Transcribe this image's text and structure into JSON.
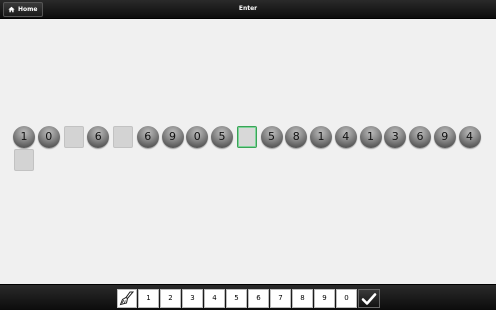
{
  "topbar": {
    "home_label": "Home",
    "title": "Enter"
  },
  "sequence": [
    {
      "type": "digit",
      "value": "1"
    },
    {
      "type": "digit",
      "value": "0"
    },
    {
      "type": "blank"
    },
    {
      "type": "digit",
      "value": "6"
    },
    {
      "type": "blank"
    },
    {
      "type": "digit",
      "value": "6"
    },
    {
      "type": "digit",
      "value": "9"
    },
    {
      "type": "digit",
      "value": "0"
    },
    {
      "type": "digit",
      "value": "5"
    },
    {
      "type": "blank",
      "active": true
    },
    {
      "type": "digit",
      "value": "5"
    },
    {
      "type": "digit",
      "value": "8"
    },
    {
      "type": "digit",
      "value": "1"
    },
    {
      "type": "digit",
      "value": "4"
    },
    {
      "type": "digit",
      "value": "1"
    },
    {
      "type": "digit",
      "value": "3"
    },
    {
      "type": "digit",
      "value": "6"
    },
    {
      "type": "digit",
      "value": "9"
    },
    {
      "type": "digit",
      "value": "4"
    },
    {
      "type": "blank"
    }
  ],
  "keypad": {
    "clear_icon": "broom-icon",
    "keys": [
      "1",
      "2",
      "3",
      "4",
      "5",
      "6",
      "7",
      "8",
      "9",
      "0"
    ],
    "confirm_icon": "checkmark-icon"
  },
  "colors": {
    "bar": "#111111",
    "active_border": "#3aa357"
  }
}
